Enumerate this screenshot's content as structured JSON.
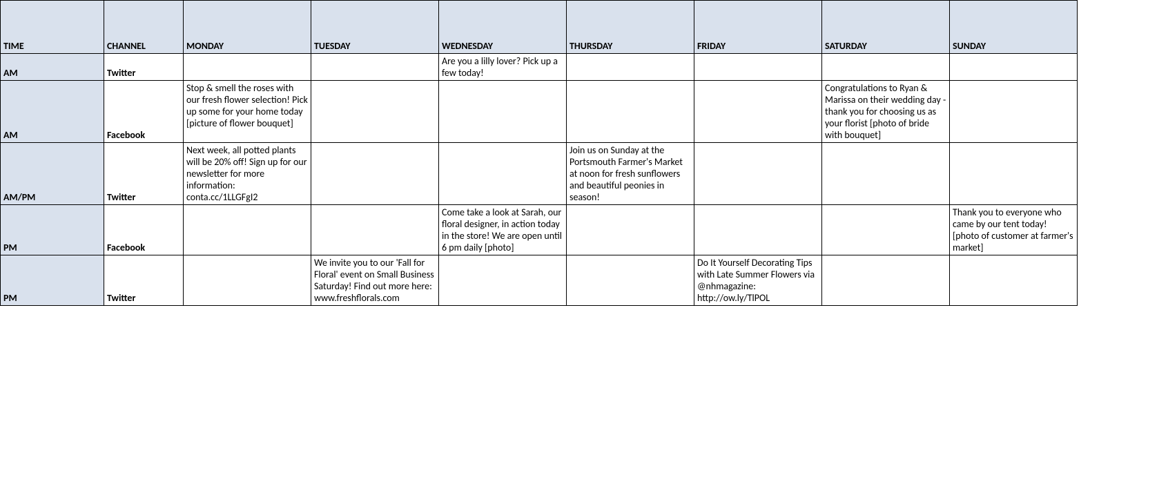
{
  "headers": {
    "time": "TIME",
    "channel": "CHANNEL",
    "monday": "MONDAY",
    "tuesday": "TUESDAY",
    "wednesday": "WEDNESDAY",
    "thursday": "THURSDAY",
    "friday": "FRIDAY",
    "saturday": "SATURDAY",
    "sunday": "SUNDAY"
  },
  "rows": [
    {
      "time": "AM",
      "channel": "Twitter",
      "mon": "",
      "tue": "",
      "wed": "Are you a lilly lover? Pick up a few today!",
      "thu": "",
      "fri": "",
      "sat": "",
      "sun": ""
    },
    {
      "time": "AM",
      "channel": "Facebook",
      "mon": "Stop & smell the roses with our fresh flower selection! Pick up some for your home today [picture of flower bouquet]",
      "tue": "",
      "wed": "",
      "thu": "",
      "fri": "",
      "sat": "Congratulations to Ryan & Marissa on their wedding day - thank you for choosing us as your florist [photo of bride with bouquet]",
      "sun": ""
    },
    {
      "time": "AM/PM",
      "channel": "Twitter",
      "mon": "Next week, all potted plants will be 20% off! Sign up for our newsletter for more information: conta.cc/1LLGFgI2",
      "tue": "",
      "wed": "",
      "thu": "Join us on Sunday at the Portsmouth Farmer's Market at noon for fresh sunflowers and beautiful peonies in season!",
      "fri": "",
      "sat": "",
      "sun": ""
    },
    {
      "time": "PM",
      "channel": "Facebook",
      "mon": "",
      "tue": "",
      "wed": "Come take a look at Sarah, our floral designer, in action today in the store! We are open until 6 pm daily [photo]",
      "thu": "",
      "fri": "",
      "sat": "",
      "sun": "Thank you to everyone who came by our tent today! [photo of customer at farmer's market]"
    },
    {
      "time": "PM",
      "channel": "Twitter",
      "mon": "",
      "tue": "We invite you to our 'Fall for Floral' event on Small Business Saturday! Find out more here: www.freshflorals.com",
      "wed": "",
      "thu": "",
      "fri": "Do It Yourself Decorating Tips with Late Summer Flowers via @nhmagazine: http://ow.ly/TlPOL",
      "sat": "",
      "sun": ""
    }
  ]
}
